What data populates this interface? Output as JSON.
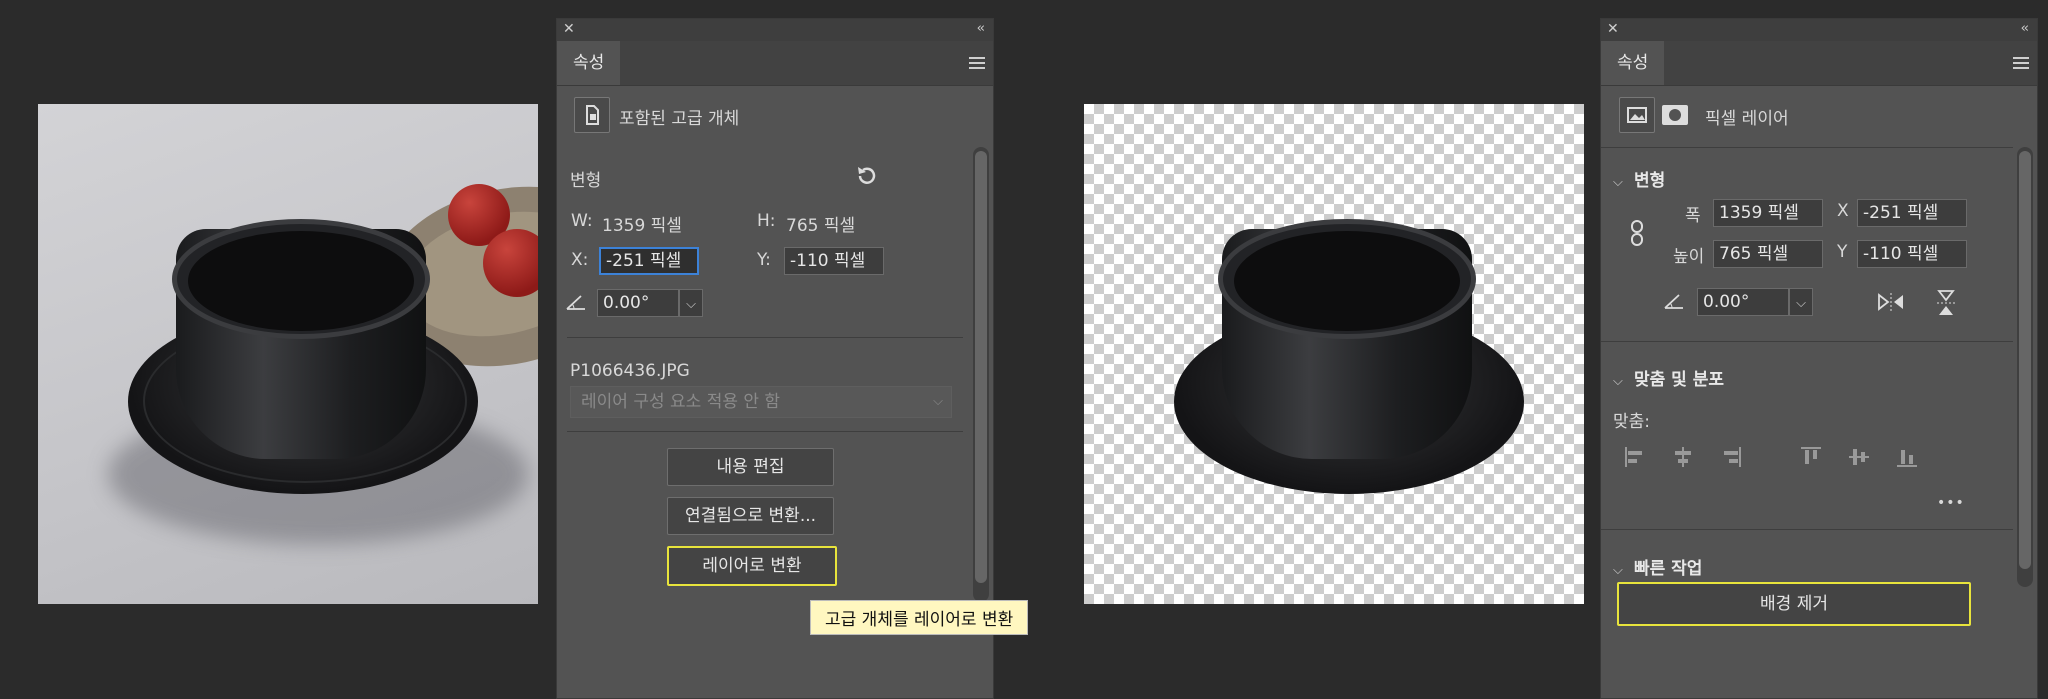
{
  "left_panel": {
    "tab": "속성",
    "object_type": "포함된 고급 개체",
    "transform_header": "변형",
    "w_label": "W:",
    "w_value": "1359 픽셀",
    "h_label": "H:",
    "h_value": "765 픽셀",
    "x_label": "X:",
    "x_value": "-251 픽셀",
    "y_label": "Y:",
    "y_value": "-110 픽셀",
    "angle_value": "0.00°",
    "filename": "P1066436.JPG",
    "layer_comp_dropdown": "레이어 구성 요소 적용 안 함",
    "buttons": {
      "edit_contents": "내용 편집",
      "convert_linked": "연결됨으로 변환...",
      "convert_to_layers": "레이어로 변환"
    },
    "tooltip": "고급 개체를 레이어로 변환"
  },
  "right_panel": {
    "tab": "속성",
    "object_type": "픽셀 레이어",
    "transform_header": "변형",
    "width_label": "폭",
    "width_value": "1359 픽셀",
    "height_label": "높이",
    "height_value": "765 픽셀",
    "x_label": "X",
    "x_value": "-251 픽셀",
    "y_label": "Y",
    "y_value": "-110 픽셀",
    "angle_value": "0.00°",
    "align_header": "맞춤 및 분포",
    "align_label": "맞춤:",
    "more": "•••",
    "quick_actions_header": "빠른 작업",
    "remove_bg_button": "배경 제거"
  },
  "colors": {
    "highlight": "#e8e43c",
    "focus": "#3c82d8",
    "panel_bg": "#535353",
    "app_bg": "#2b2b2b"
  }
}
